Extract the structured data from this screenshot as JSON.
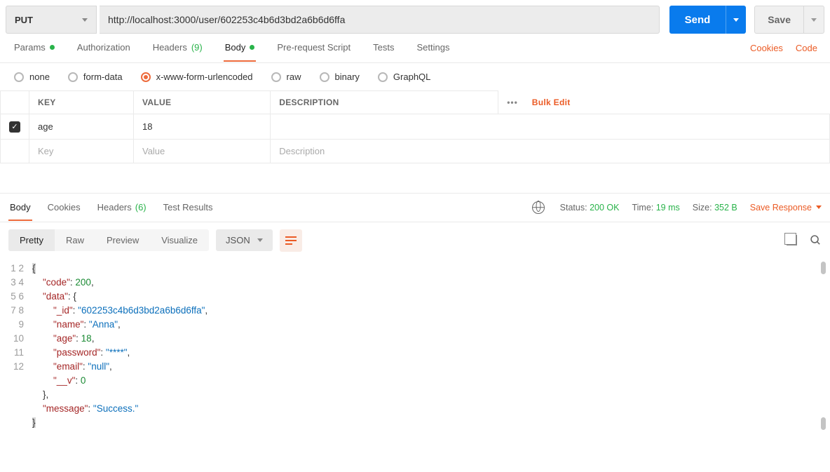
{
  "request": {
    "method": "PUT",
    "url": "http://localhost:3000/user/602253c4b6d3bd2a6b6d6ffa",
    "send_label": "Send",
    "save_label": "Save"
  },
  "req_tabs": {
    "params": "Params",
    "authorization": "Authorization",
    "headers": "Headers",
    "headers_count": "(9)",
    "body": "Body",
    "prerequest": "Pre-request Script",
    "tests": "Tests",
    "settings": "Settings",
    "cookies_link": "Cookies",
    "code_link": "Code"
  },
  "body_types": {
    "none": "none",
    "formdata": "form-data",
    "urlencoded": "x-www-form-urlencoded",
    "raw": "raw",
    "binary": "binary",
    "graphql": "GraphQL"
  },
  "kv": {
    "key_header": "KEY",
    "value_header": "VALUE",
    "desc_header": "DESCRIPTION",
    "bulk_edit": "Bulk Edit",
    "rows": [
      {
        "key": "age",
        "value": "18",
        "desc": ""
      }
    ],
    "key_placeholder": "Key",
    "value_placeholder": "Value",
    "desc_placeholder": "Description"
  },
  "resp_tabs": {
    "body": "Body",
    "cookies": "Cookies",
    "headers": "Headers",
    "headers_count": "(6)",
    "test_results": "Test Results"
  },
  "resp_meta": {
    "status_label": "Status:",
    "status_value": "200 OK",
    "time_label": "Time:",
    "time_value": "19 ms",
    "size_label": "Size:",
    "size_value": "352 B",
    "save_response": "Save Response"
  },
  "view": {
    "pretty": "Pretty",
    "raw": "Raw",
    "preview": "Preview",
    "visualize": "Visualize",
    "lang": "JSON"
  },
  "response_json": {
    "code": 200,
    "data": {
      "_id": "602253c4b6d3bd2a6b6d6ffa",
      "name": "Anna",
      "age": 18,
      "password": "****",
      "email": "null",
      "__v": 0
    },
    "message": "Success."
  }
}
